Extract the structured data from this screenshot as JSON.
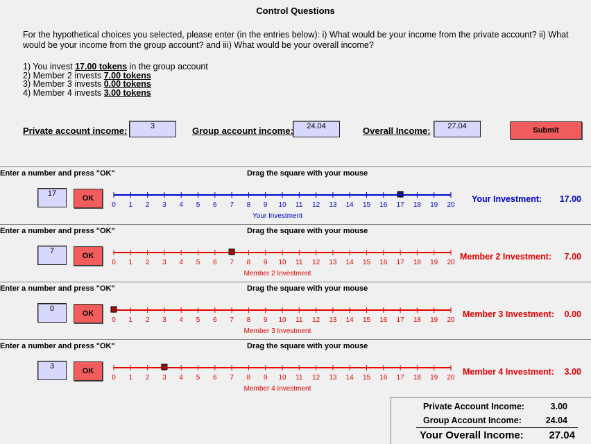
{
  "header": {
    "title": "Control Questions",
    "instructions": "For the hypothetical choices you selected, please enter (in the entries below): i) What would be your income from the private account? ii) What would be your income from the group account? and  iii) What would be your overall income?"
  },
  "choices": [
    {
      "prefix": "1) You invest ",
      "value": "17.00 tokens",
      "suffix": " in the group account"
    },
    {
      "prefix": "2) Member 2 invests ",
      "value": "7.00 tokens",
      "suffix": ""
    },
    {
      "prefix": "3) Member 3 invests ",
      "value": "0.00 tokens",
      "suffix": ""
    },
    {
      "prefix": "4) Member 4 invests ",
      "value": "3.00 tokens",
      "suffix": ""
    }
  ],
  "answers": {
    "private_label": "Private account income:",
    "private_value": "3",
    "group_label": "Group account income:",
    "group_value": "24.04",
    "overall_label": "Overall Income:",
    "overall_value": "27.04",
    "submit_label": "Submit"
  },
  "colors": {
    "blue": "#0000cc",
    "red": "#e00000",
    "field_bg": "#d8d8ff",
    "button": "#f25c5c"
  },
  "sections": [
    {
      "left_label": "Enter a number and press \"OK\"",
      "mid_label": "Drag the square with your mouse",
      "input_value": "17",
      "ok_label": "OK",
      "slider_value": 17,
      "color": "#0000cc",
      "slider_caption": "Your Investment",
      "inv_label": "Your Investment:",
      "inv_value": "17.00"
    },
    {
      "left_label": "Enter a number and press \"OK\"",
      "mid_label": "Drag the square with your mouse",
      "input_value": "7",
      "ok_label": "OK",
      "slider_value": 7,
      "color": "#e00000",
      "slider_caption": "Member 2 Investment",
      "inv_label": "Member 2 Investment:",
      "inv_value": "7.00"
    },
    {
      "left_label": "Enter a number and press \"OK\"",
      "mid_label": "Drag the square with your mouse",
      "input_value": "0",
      "ok_label": "OK",
      "slider_value": 0,
      "color": "#e00000",
      "slider_caption": "Member 3 Investment",
      "inv_label": "Member 3 Investment:",
      "inv_value": "0.00"
    },
    {
      "left_label": "Enter a number and press \"OK\"",
      "mid_label": "Drag the square with your mouse",
      "input_value": "3",
      "ok_label": "OK",
      "slider_value": 3,
      "color": "#e00000",
      "slider_caption": "Member 4 Investment",
      "inv_label": "Member 4 Investment:",
      "inv_value": "3.00"
    }
  ],
  "slider_ticks": [
    "0",
    "1",
    "2",
    "3",
    "4",
    "5",
    "6",
    "7",
    "8",
    "9",
    "10",
    "11",
    "12",
    "13",
    "14",
    "15",
    "16",
    "17",
    "18",
    "19",
    "20"
  ],
  "summary": {
    "private_label": "Private Account Income:",
    "private_value": "3.00",
    "group_label": "Group Account Income:",
    "group_value": "24.04",
    "overall_label": "Your Overall Income:",
    "overall_value": "27.04"
  }
}
